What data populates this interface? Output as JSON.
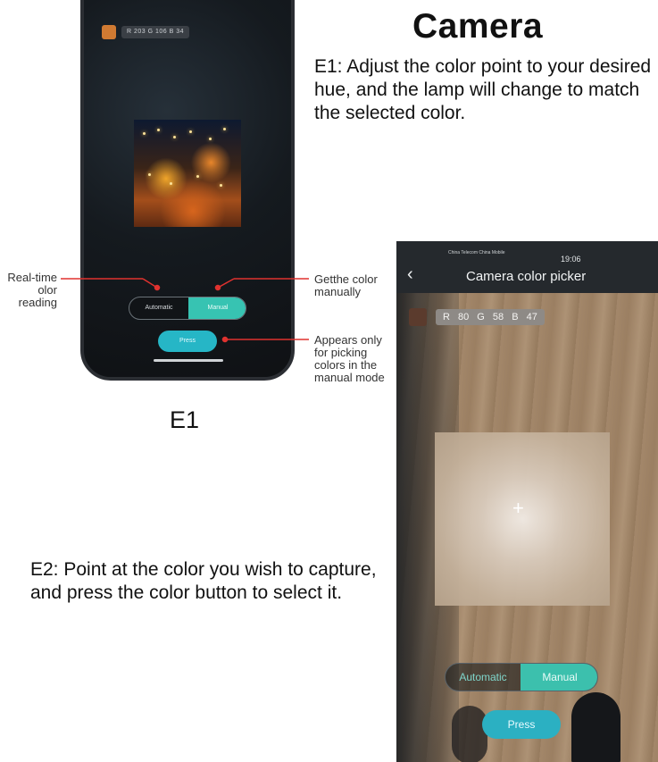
{
  "heading": {
    "title": "Camera",
    "e1_description": "E1: Adjust the color point to your desired hue, and the lamp will change to match the selected color.",
    "e2_description": "E2: Point at the color you wish to capture, and press the color button to select it.",
    "e1_label": "E1"
  },
  "callouts": {
    "realtime": "Real-time olor reading",
    "get_color": "Getthe color manually",
    "appears_only": "Appears only for picking colors in the manual mode"
  },
  "phone_e1": {
    "swatch_color": "#d07a32",
    "rgb_readout": "R 203  G 106  B 34",
    "toggle": {
      "automatic": "Automatic",
      "manual": "Manual",
      "selected": "Manual"
    },
    "press_button": "Press"
  },
  "phone_e2": {
    "status_left": "China Telecom  China Mobile",
    "status_right": "19:06",
    "back_icon": "chevron-left-icon",
    "title": "Camera color picker",
    "swatch_color": "#5b3b2d",
    "rgb_readout": "R 80  G 58  B 47",
    "crosshair": "+",
    "toggle": {
      "automatic": "Automatic",
      "manual": "Manual",
      "selected": "Manual"
    },
    "press_button": "Press"
  },
  "colors": {
    "callout_line": "#e0322f",
    "toggle_active": "#3cc0ad",
    "press_button": "#2bb0c2"
  }
}
